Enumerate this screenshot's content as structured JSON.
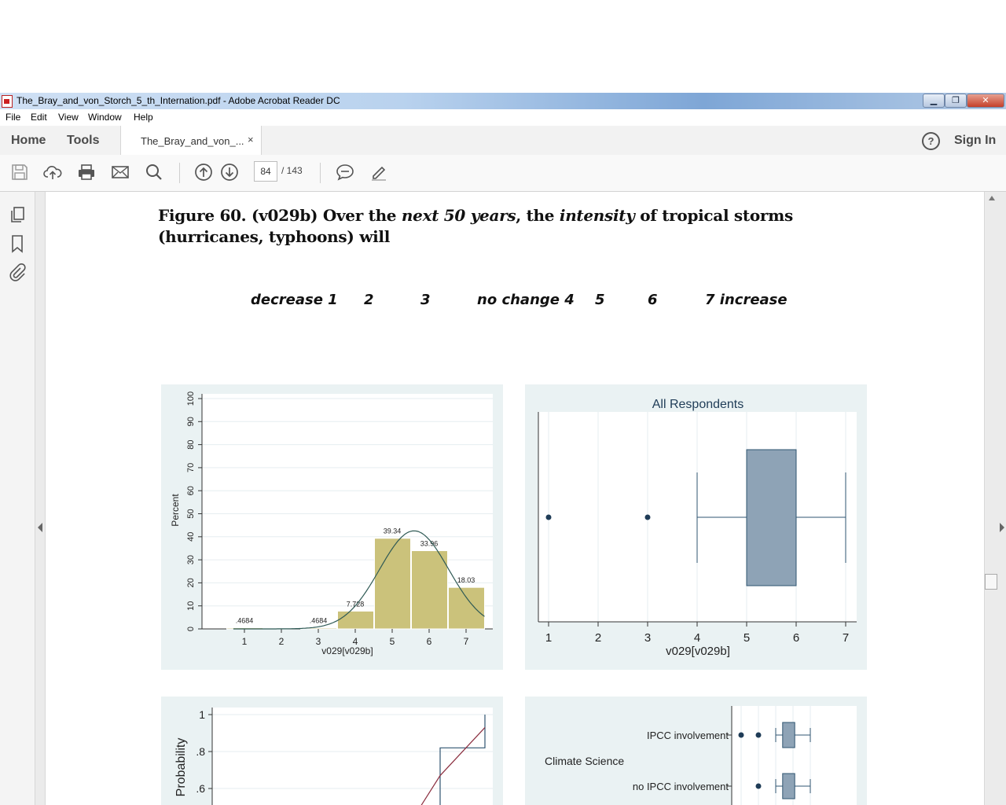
{
  "window": {
    "title": "The_Bray_and_von_Storch_5_th_Internation.pdf - Adobe Acrobat Reader DC",
    "minimize": "▁",
    "restore": "❐",
    "close": "✕"
  },
  "menu": {
    "items": [
      "File",
      "Edit",
      "View",
      "Window",
      "Help"
    ]
  },
  "tabs": {
    "home": "Home",
    "tools": "Tools",
    "document": "The_Bray_and_von_...",
    "close": "×",
    "help": "?",
    "sign_in": "Sign In"
  },
  "toolbar": {
    "icons": [
      "save-icon",
      "cloud-upload-icon",
      "print-icon",
      "email-icon",
      "search-icon",
      "page-up-icon",
      "page-down-icon",
      "comment-icon",
      "sign-pen-icon"
    ],
    "current_page": "84",
    "total_pages": "/ 143"
  },
  "left_panel": {
    "icons": [
      "pages-icon",
      "bookmark-icon",
      "attachment-icon"
    ]
  },
  "document": {
    "figure_label": "Figure 60.",
    "title_parts": [
      "(v029b) Over the ",
      "next 50 years",
      ", the ",
      "intensity",
      " of tropical storms (hurricanes, typhoons) will"
    ],
    "scale": [
      "decrease  1",
      "2",
      "3",
      "no change  4",
      "5",
      "6",
      "7 increase"
    ]
  },
  "colors": {
    "panel_bg": "#eaf2f3",
    "bar_fill": "#cbc27b",
    "box_fill": "#8ea3b6",
    "curve": "#2f5a55",
    "step_line": "#2f5470",
    "cdf_line": "#8b2e3f",
    "dot": "#1f3c57"
  },
  "chart_data": [
    {
      "type": "bar",
      "title": "",
      "xlabel": "v029[v029b]",
      "ylabel": "Percent",
      "categories": [
        "1",
        "2",
        "3",
        "4",
        "5",
        "6",
        "7"
      ],
      "values": [
        0.4684,
        0,
        0.4684,
        7.728,
        39.34,
        33.96,
        18.03
      ],
      "data_labels": [
        ".4684",
        "",
        ".4684",
        "7.728",
        "39.34",
        "33.96",
        "18.03"
      ],
      "overlay": "normal density curve",
      "ylim": [
        0,
        100
      ],
      "yticks": [
        "0",
        "10",
        "20",
        "30",
        "40",
        "50",
        "60",
        "70",
        "80",
        "90",
        "100"
      ],
      "xticks": [
        "1",
        "2",
        "3",
        "4",
        "5",
        "6",
        "7"
      ],
      "grid": true
    },
    {
      "type": "boxplot",
      "title": "All Respondents",
      "xlabel": "v029[v029b]",
      "xticks": [
        "1",
        "2",
        "3",
        "4",
        "5",
        "6",
        "7"
      ],
      "whisker_low": 4,
      "q1": 5,
      "q3": 6,
      "whisker_high": 7,
      "outliers": [
        1,
        3
      ],
      "grid": true
    },
    {
      "type": "line",
      "ylabel": "Probability",
      "yticks": [
        "1",
        ".8",
        ".6"
      ],
      "ylim_visible": [
        0.6,
        1
      ],
      "series": [
        {
          "values_desc": "empirical step cumulative"
        },
        {
          "values_desc": "theoretical cumulative"
        }
      ]
    },
    {
      "type": "boxplot",
      "group_label": "Climate Science",
      "rows": [
        {
          "label": "IPCC involvement",
          "outliers": [
            3,
            4
          ],
          "whisker_low": 5,
          "q1": 5.4,
          "q3": 6.1,
          "whisker_high": 7
        },
        {
          "label": "no IPCC involvement",
          "outliers": [
            4
          ],
          "whisker_low": 5,
          "q1": 5.4,
          "q3": 6.1,
          "whisker_high": 7
        }
      ]
    }
  ]
}
